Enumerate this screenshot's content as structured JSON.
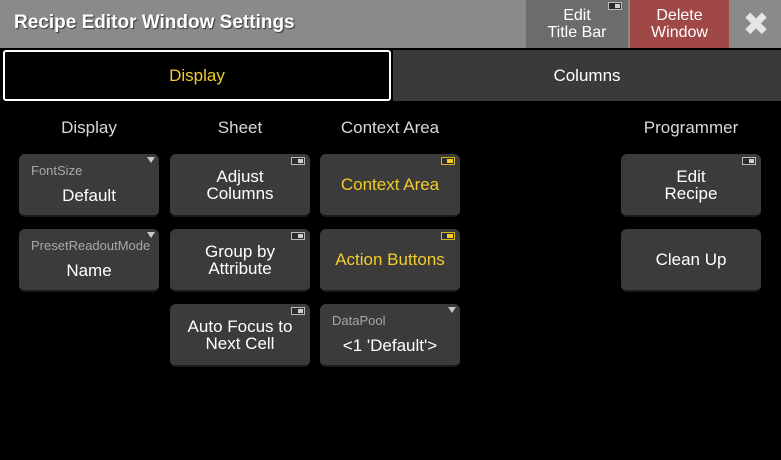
{
  "window": {
    "title": "Recipe Editor Window Settings",
    "edit_title_bar_label": "Edit\nTitle Bar",
    "delete_window_label": "Delete\nWindow",
    "close_glyph": "✖"
  },
  "tabs": [
    {
      "label": "Display",
      "active": true
    },
    {
      "label": "Columns",
      "active": false
    }
  ],
  "columns": {
    "display": "Display",
    "sheet": "Sheet",
    "context_area": "Context Area",
    "programmer": "Programmer"
  },
  "display": {
    "fontsize": {
      "title": "FontSize",
      "value": "Default"
    },
    "preset_readout_mode": {
      "title": "PresetReadoutMode",
      "value": "Name"
    }
  },
  "sheet": {
    "adjust_columns": "Adjust\nColumns",
    "group_by_attribute": "Group by\nAttribute",
    "auto_focus": "Auto Focus to\nNext Cell"
  },
  "context": {
    "context_area": "Context Area",
    "action_buttons": "Action Buttons",
    "datapool": {
      "title": "DataPool",
      "value": "<1 'Default'>"
    }
  },
  "programmer": {
    "edit_recipe": "Edit\nRecipe",
    "clean_up": "Clean Up"
  },
  "colors": {
    "accent_yellow": "#f2cc2a",
    "delete_red": "#a04848",
    "titlebar_gray": "#8a8a8a",
    "button_gray": "#3b3b3b"
  }
}
